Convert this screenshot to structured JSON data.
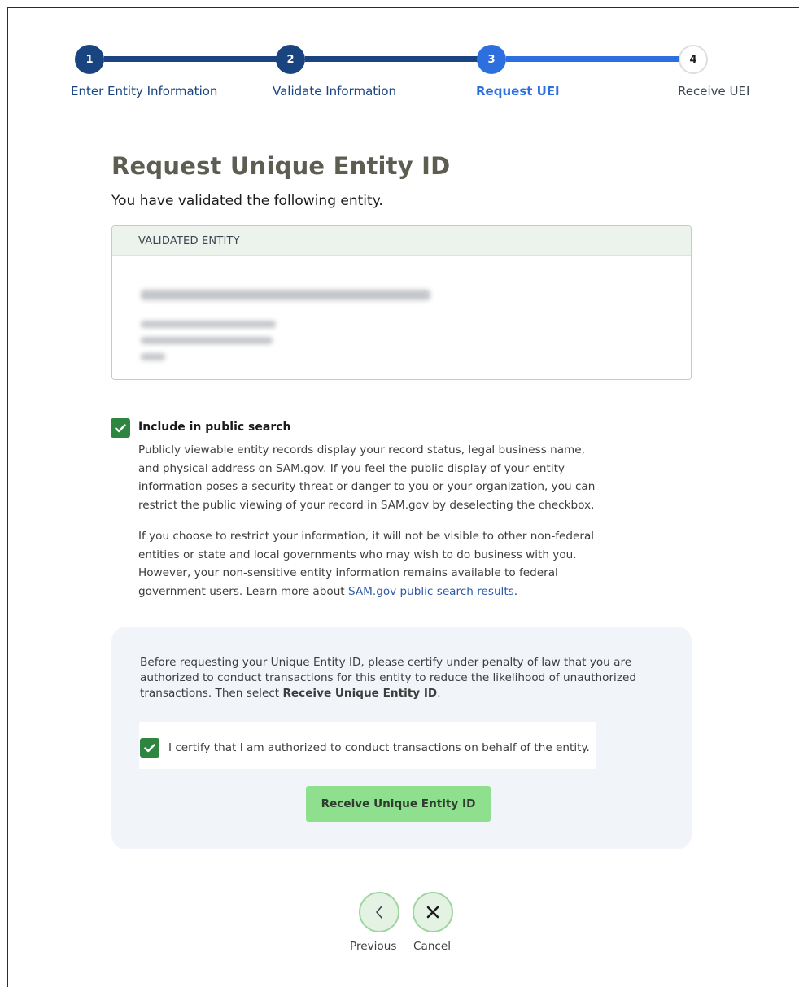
{
  "stepper": {
    "steps": [
      {
        "number": "1",
        "label": "Enter Entity Information",
        "state": "complete"
      },
      {
        "number": "2",
        "label": "Validate Information",
        "state": "complete"
      },
      {
        "number": "3",
        "label": "Request UEI",
        "state": "current"
      },
      {
        "number": "4",
        "label": "Receive UEI",
        "state": "incomplete"
      }
    ]
  },
  "header": {
    "title": "Request Unique Entity ID",
    "subtitle": "You have validated the following entity."
  },
  "entity_card": {
    "header": "VALIDATED ENTITY"
  },
  "public_search": {
    "checked": true,
    "label": "Include in public search",
    "paragraph1_lines": [
      "Publicly viewable entity records display your record status, legal business name,",
      "and physical address on SAM.gov. If you feel the public display of your entity",
      "information poses a security threat or danger to you or your organization, you can",
      "restrict the public viewing of your record in SAM.gov by deselecting the checkbox."
    ],
    "paragraph2_lines": [
      "If you choose to restrict your information, it will not be visible to other non-federal",
      "entities or state and local governments who may wish to do business with you.",
      "However, your non-sensitive entity information remains available to federal"
    ],
    "paragraph2_last_prefix": "government users. Learn more about ",
    "paragraph2_link": "SAM.gov public search results",
    "paragraph2_last_suffix": "."
  },
  "certification": {
    "line1": "Before requesting your Unique Entity ID, please certify under penalty of law that you are",
    "line2": "authorized to conduct transactions for this entity to reduce the likelihood of unauthorized",
    "line3_prefix": "transactions. Then select ",
    "line3_bold": "Receive Unique Entity ID",
    "line3_suffix": ".",
    "checked": true,
    "checkbox_label": "I certify that I am authorized to conduct transactions on behalf of the entity.",
    "button_label": "Receive Unique Entity ID"
  },
  "footer": {
    "previous_label": "Previous",
    "cancel_label": "Cancel"
  },
  "colors": {
    "step_complete": "#1a4480",
    "step_current": "#2e6fe0",
    "checkbox_green": "#2e8540",
    "button_green": "#8ee08e",
    "entity_header_bg": "#ecf3ec",
    "cert_panel_bg": "#f1f5f9",
    "title_color": "#5d5d52"
  }
}
